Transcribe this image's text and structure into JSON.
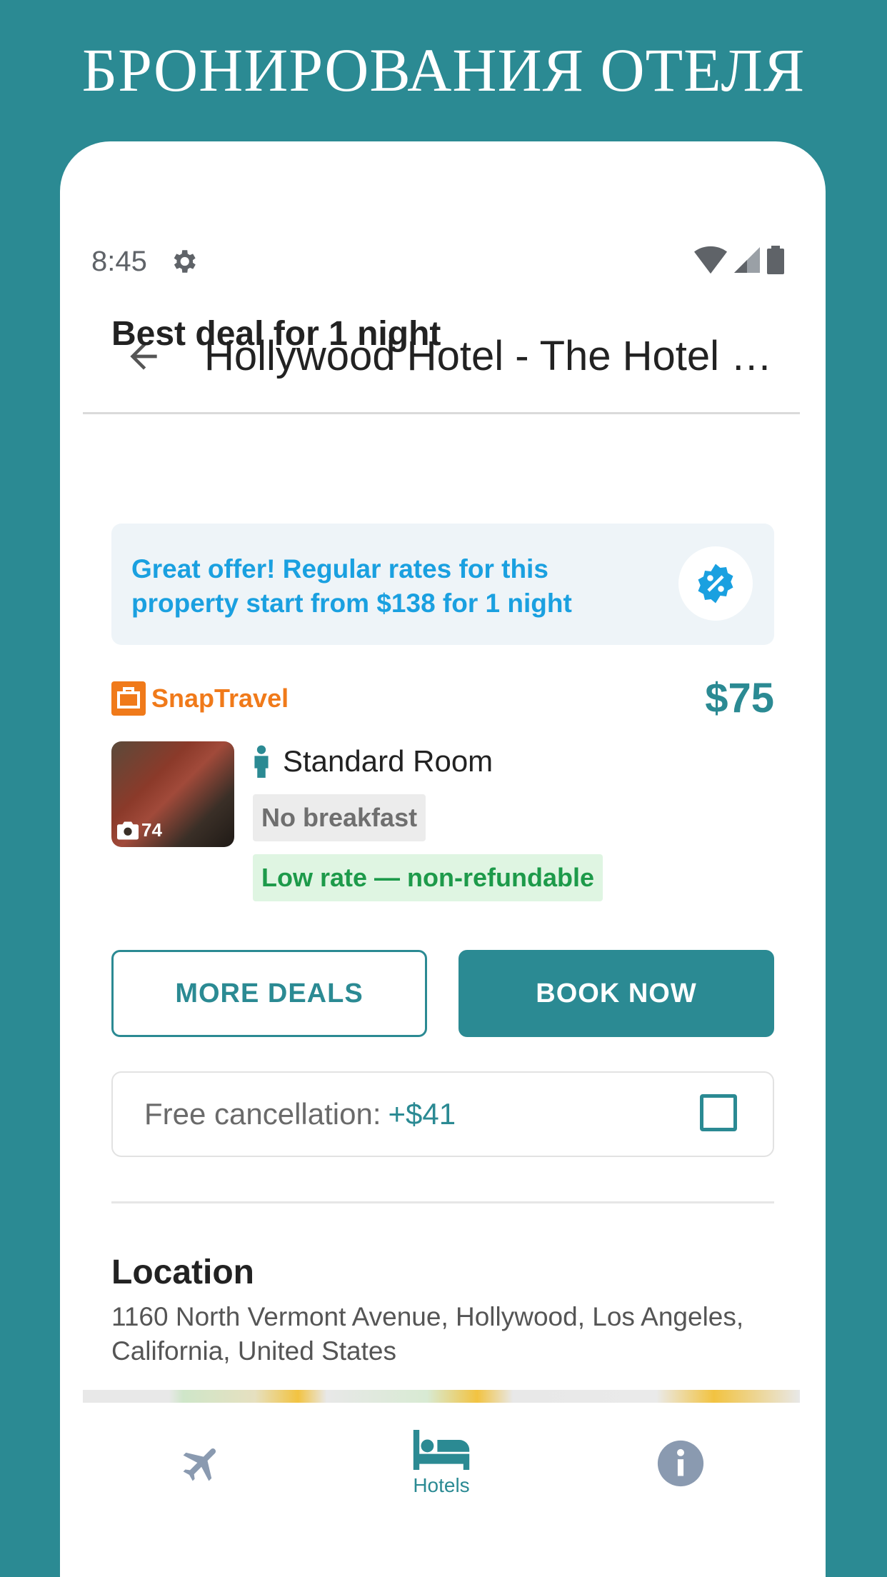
{
  "promo": {
    "title": "БРОНИРОВАНИЯ ОТЕЛЯ"
  },
  "status_bar": {
    "time": "8:45"
  },
  "app_bar": {
    "title": "Hollywood Hotel - The Hotel of…"
  },
  "deal": {
    "heading": "Best deal for 1 night",
    "offer_text": "Great offer! Regular rates for this property start from $138 for 1 night",
    "provider": "SnapTravel",
    "price": "$75",
    "photo_count": "74",
    "room_name": "Standard Room",
    "tags": [
      "No breakfast",
      "Low rate — non-refundable"
    ],
    "more_deals_label": "MORE DEALS",
    "book_now_label": "BOOK NOW",
    "cancellation_label": "Free cancellation:",
    "cancellation_amount": "+$41"
  },
  "location": {
    "heading": "Location",
    "address": "1160 North Vermont Avenue, Hollywood, Los Angeles, California, United States"
  },
  "bottom_nav": {
    "items": [
      {
        "icon": "airplane-icon",
        "label": ""
      },
      {
        "icon": "bed-icon",
        "label": "Hotels"
      },
      {
        "icon": "info-icon",
        "label": ""
      }
    ]
  },
  "colors": {
    "brand": "#2b8a93",
    "offer_text": "#1aa0e0",
    "provider": "#f07a1a",
    "green_tag": "#1d9a4a"
  }
}
